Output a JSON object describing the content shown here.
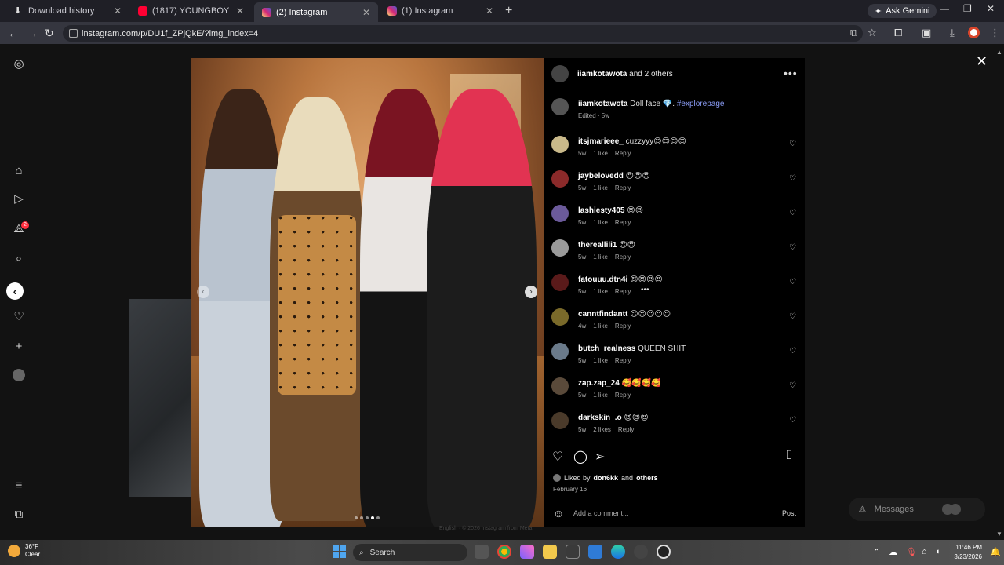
{
  "browser": {
    "tabs": [
      {
        "title": "Download history",
        "icon": "download-icon",
        "active": false
      },
      {
        "title": "(1817) YOUNGBOY SISTER - Yo",
        "icon": "youtube-icon",
        "active": false
      },
      {
        "title": "(2) Instagram",
        "icon": "instagram-icon",
        "active": true
      },
      {
        "title": "(1) Instagram",
        "icon": "instagram-icon",
        "active": false
      }
    ],
    "new_tab": "+",
    "ask_gemini": "Ask Gemini",
    "url": "instagram.com/p/DU1f_ZPjQkE/?img_index=4"
  },
  "left_rail": {
    "notification_badge": "2"
  },
  "post": {
    "header": {
      "username": "iiamkotawota",
      "others": "and 2 others"
    },
    "caption": {
      "username": "iiamkotawota",
      "text": "Doll face 💎.",
      "hashtag": "#explorepage",
      "meta": "Edited · 5w"
    },
    "comments": [
      {
        "user": "itsjmarieee_",
        "text": "cuzzyyy😍😍😍😍",
        "age": "5w",
        "likes": "1 like",
        "reply": "Reply"
      },
      {
        "user": "jaybelovedd",
        "text": "😍😍😍",
        "age": "5w",
        "likes": "1 like",
        "reply": "Reply"
      },
      {
        "user": "lashiesty405",
        "text": "😍😍",
        "age": "5w",
        "likes": "1 like",
        "reply": "Reply"
      },
      {
        "user": "thereallili1",
        "text": "😍😍",
        "age": "5w",
        "likes": "1 like",
        "reply": "Reply"
      },
      {
        "user": "fatouuu.dtn4i",
        "text": "😍😍😍😍",
        "age": "5w",
        "likes": "1 like",
        "reply": "Reply"
      },
      {
        "user": "canntfindantt",
        "text": "😍😍😍😍😍",
        "age": "4w",
        "likes": "1 like",
        "reply": "Reply"
      },
      {
        "user": "butch_realness",
        "text": "QUEEN SHIT",
        "age": "5w",
        "likes": "1 like",
        "reply": "Reply"
      },
      {
        "user": "zap.zap_24",
        "text": "🥰🥰🥰🥰",
        "age": "5w",
        "likes": "1 like",
        "reply": "Reply"
      },
      {
        "user": "darkskin_.o",
        "text": "😍😍😍",
        "age": "5w",
        "likes": "2 likes",
        "reply": "Reply"
      }
    ],
    "liked_by_prefix": "Liked by",
    "liked_by_user": "don6kk",
    "liked_by_suffix": "and",
    "liked_by_others": "others",
    "date": "February 16",
    "add_comment_placeholder": "Add a comment...",
    "post_button": "Post"
  },
  "footer": "English  ·  © 2026 Instagram from Meta",
  "messages": {
    "label": "Messages",
    "badge": "2"
  },
  "taskbar": {
    "temperature": "36°F",
    "condition": "Clear",
    "search": "Search",
    "time": "11:46 PM",
    "date": "3/23/2026"
  }
}
